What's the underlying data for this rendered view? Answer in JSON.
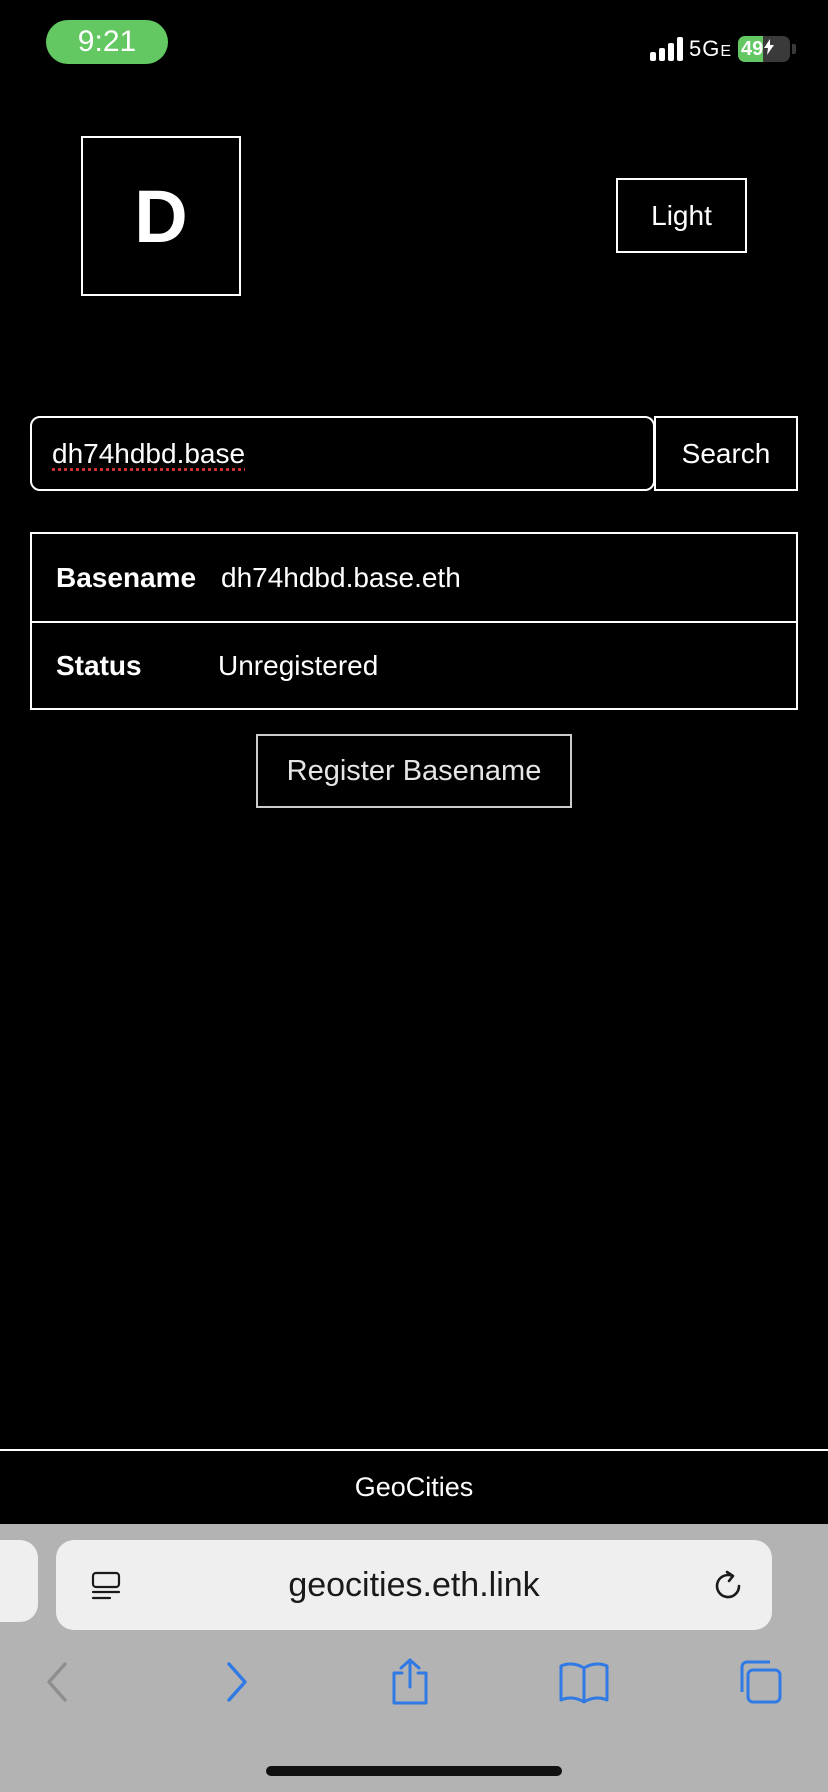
{
  "status_bar": {
    "time": "9:21",
    "network": "5G",
    "network_suffix": "E",
    "battery_level": "49",
    "battery_percent": 49,
    "charging": true
  },
  "header": {
    "logo_letter": "D",
    "theme_toggle_label": "Light"
  },
  "search": {
    "input_value": "dh74hdbd.base",
    "button_label": "Search"
  },
  "result": {
    "rows": [
      {
        "label": "Basename",
        "value": "dh74hdbd.base.eth"
      },
      {
        "label": "Status",
        "value": "Unregistered"
      }
    ]
  },
  "register_button_label": "Register Basename",
  "footer": {
    "text": "GeoCities"
  },
  "browser": {
    "url": "geocities.eth.link",
    "icons": [
      "reader-mode-icon",
      "reload-icon",
      "back-icon",
      "forward-icon",
      "share-icon",
      "bookmarks-icon",
      "tabs-icon"
    ],
    "accent_color": "#2f7ae5",
    "disabled_color": "#8e8e8e"
  },
  "colors": {
    "background": "#000000",
    "foreground": "#ffffff",
    "status_green": "#63c862"
  }
}
